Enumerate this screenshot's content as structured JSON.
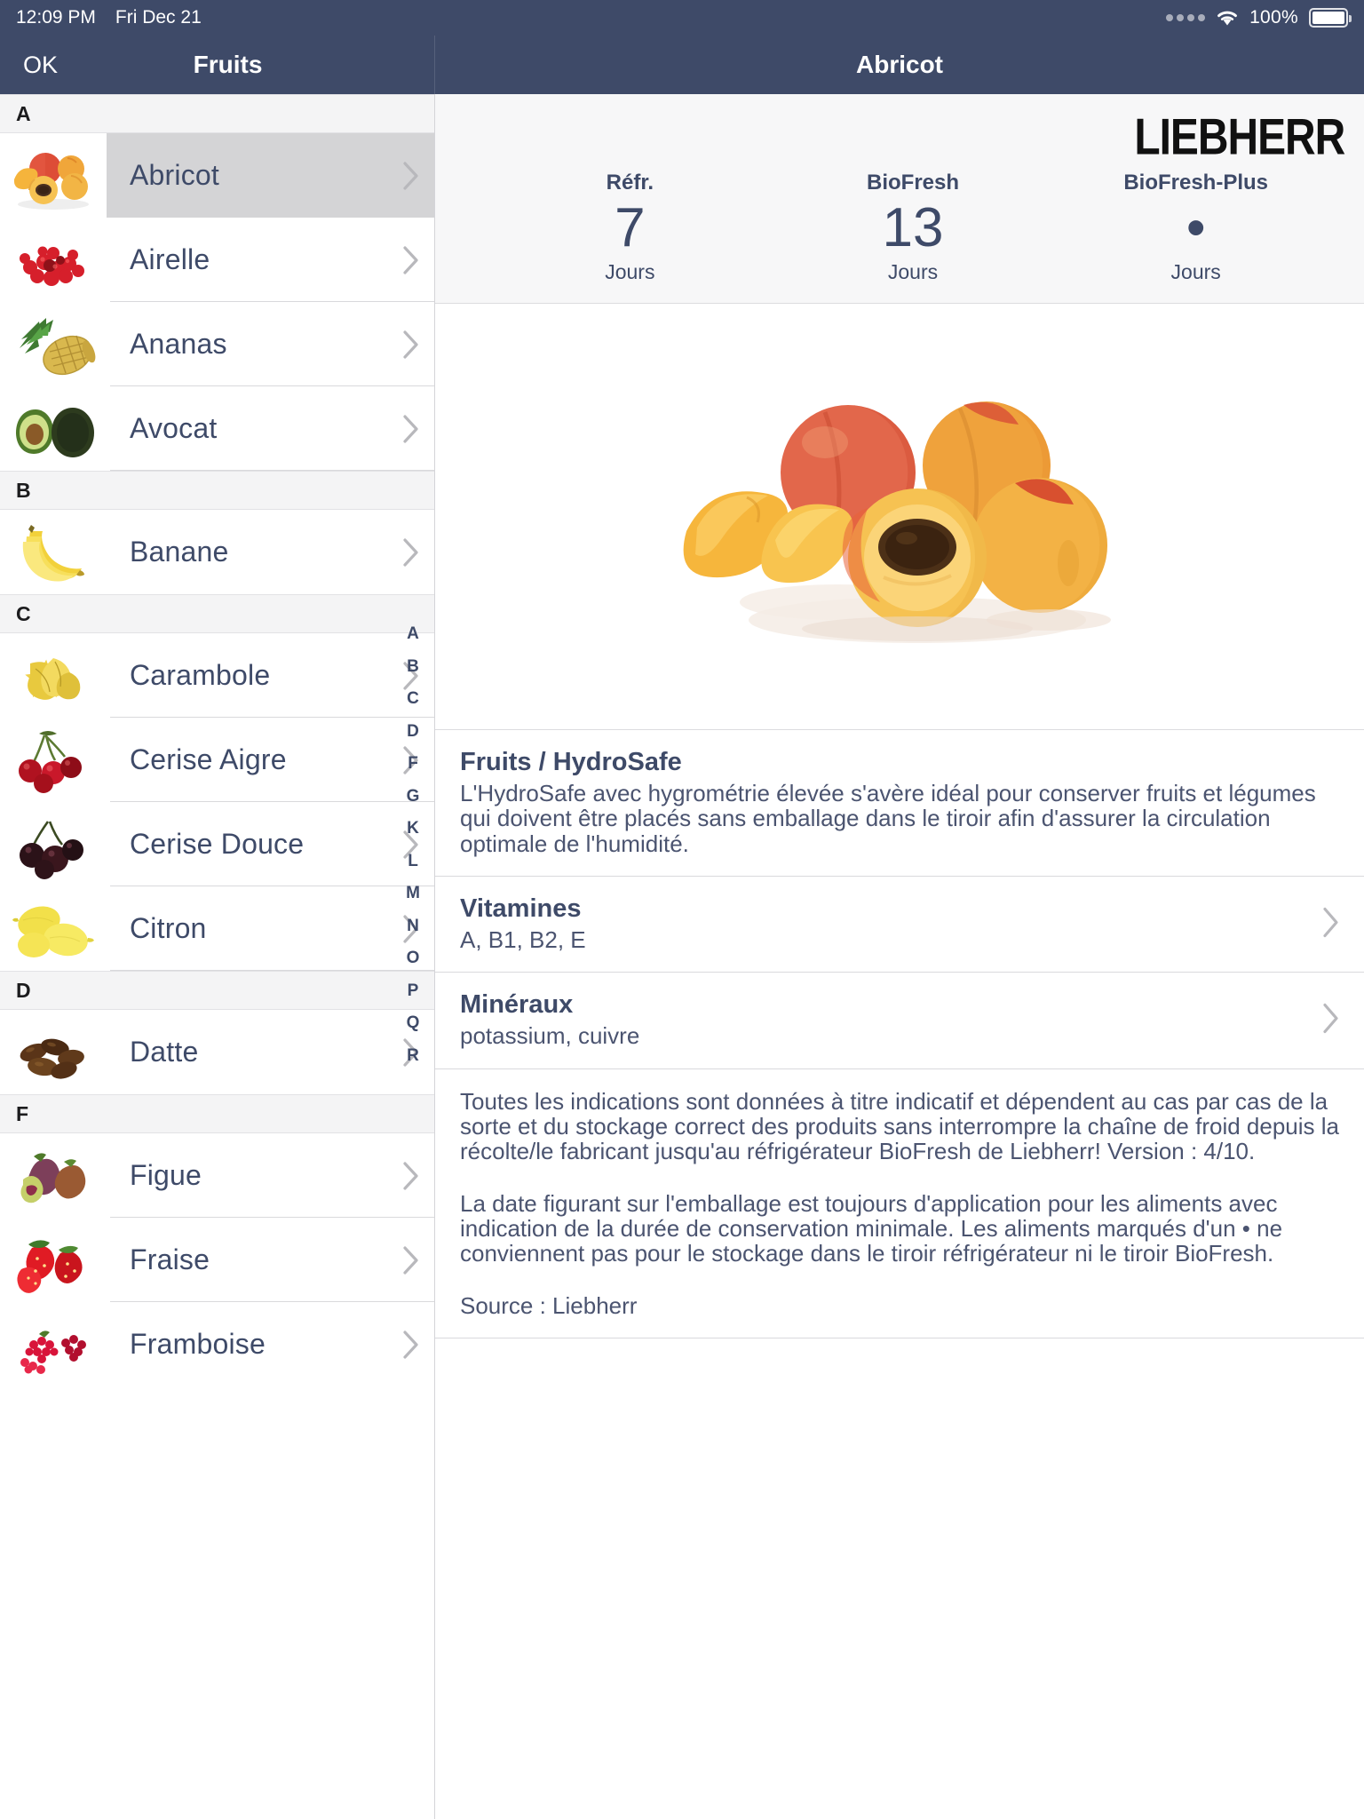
{
  "status_bar": {
    "time": "12:09 PM",
    "date": "Fri Dec 21",
    "battery_percent": "100%",
    "wifi_icon": "wifi-icon",
    "signal_icon": "signal-dots-icon",
    "battery_icon": "battery-icon"
  },
  "nav": {
    "left_button": "OK",
    "left_title": "Fruits",
    "right_title": "Abricot"
  },
  "sidebar": {
    "sections": [
      {
        "letter": "A",
        "items": [
          {
            "name": "Abricot",
            "thumb": "apricots-thumb",
            "selected": true
          },
          {
            "name": "Airelle",
            "thumb": "cranberries-thumb",
            "selected": false
          },
          {
            "name": "Ananas",
            "thumb": "pineapple-thumb",
            "selected": false
          },
          {
            "name": "Avocat",
            "thumb": "avocado-thumb",
            "selected": false
          }
        ]
      },
      {
        "letter": "B",
        "items": [
          {
            "name": "Banane",
            "thumb": "bananas-thumb",
            "selected": false
          }
        ]
      },
      {
        "letter": "C",
        "items": [
          {
            "name": "Carambole",
            "thumb": "starfruit-thumb",
            "selected": false
          },
          {
            "name": "Cerise Aigre",
            "thumb": "sour-cherries-thumb",
            "selected": false
          },
          {
            "name": "Cerise Douce",
            "thumb": "sweet-cherries-thumb",
            "selected": false
          },
          {
            "name": "Citron",
            "thumb": "lemons-thumb",
            "selected": false
          }
        ]
      },
      {
        "letter": "D",
        "items": [
          {
            "name": "Datte",
            "thumb": "dates-thumb",
            "selected": false
          }
        ]
      },
      {
        "letter": "F",
        "items": [
          {
            "name": "Figue",
            "thumb": "figs-thumb",
            "selected": false
          },
          {
            "name": "Fraise",
            "thumb": "strawberries-thumb",
            "selected": false
          },
          {
            "name": "Framboise",
            "thumb": "raspberries-thumb",
            "selected": false
          }
        ]
      }
    ],
    "alpha_index": [
      "A",
      "B",
      "C",
      "D",
      "F",
      "G",
      "K",
      "L",
      "M",
      "N",
      "O",
      "P",
      "Q",
      "R"
    ]
  },
  "detail": {
    "brand": "LIEBHERR",
    "hero_image": "apricots-photo",
    "freshness": [
      {
        "label": "Réfr.",
        "value": "7",
        "unit": "Jours"
      },
      {
        "label": "BioFresh",
        "value": "13",
        "unit": "Jours"
      },
      {
        "label": "BioFresh-Plus",
        "value": "•",
        "unit": "Jours"
      }
    ],
    "hydrosafe": {
      "title": "Fruits / HydroSafe",
      "text": "L'HydroSafe avec hygrométrie élevée s'avère idéal pour conserver fruits et légumes qui doivent être placés sans emballage dans le tiroir afin d'assurer la circulation optimale de l'humidité."
    },
    "vitamines": {
      "title": "Vitamines",
      "value": "A, B1, B2, E"
    },
    "mineraux": {
      "title": "Minéraux",
      "value": "potassium, cuivre"
    },
    "disclaimer_1": "Toutes les indications sont données à titre indicatif et dépendent au cas par cas de la sorte et du stockage correct des produits sans interrompre la chaîne de froid depuis la récolte/le fabricant jusqu'au réfrigérateur BioFresh de Liebherr! Version : 4/10.",
    "disclaimer_2": "La date figurant sur l'emballage est toujours d'application pour les aliments avec indication de la durée de conservation minimale. Les aliments marqués d'un • ne conviennent pas pour le stockage dans le tiroir réfrigérateur ni le tiroir BioFresh.",
    "source": "Source : Liebherr"
  },
  "colors": {
    "navy": "#3e4a68",
    "text_body": "#4b5470",
    "selected_row": "#d4d4d6",
    "section_header_bg": "#f4f4f5",
    "fresh_bg": "#f7f7f8"
  }
}
